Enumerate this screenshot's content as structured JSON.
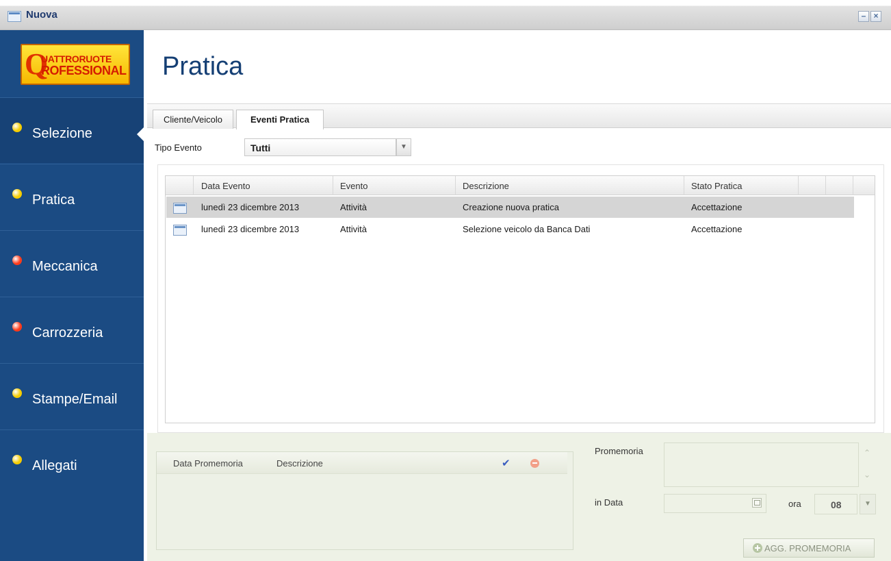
{
  "window": {
    "title": "Nuova",
    "minimize_glyph": "–",
    "close_glyph": "×"
  },
  "logo": {
    "initial": "Q",
    "line1": "UATTRORUOTE",
    "line2": "ROFESSIONAL"
  },
  "sidebar": {
    "items": [
      {
        "label": "Selezione",
        "dot_color": "#f5cc00",
        "active": true
      },
      {
        "label": "Pratica",
        "dot_color": "#f5cc00",
        "active": false
      },
      {
        "label": "Meccanica",
        "dot_color": "#ff3a1a",
        "active": false
      },
      {
        "label": "Carrozzeria",
        "dot_color": "#ff3a1a",
        "active": false
      },
      {
        "label": "Stampe/Email",
        "dot_color": "#f5cc00",
        "active": false
      },
      {
        "label": "Allegati",
        "dot_color": "#f5cc00",
        "active": false
      }
    ]
  },
  "page": {
    "title": "Pratica"
  },
  "tabs": [
    {
      "label": "Cliente/Veicolo",
      "active": false
    },
    {
      "label": "Eventi Pratica",
      "active": true
    }
  ],
  "filter": {
    "label": "Tipo Evento",
    "value": "Tutti",
    "icon": "chevron-down-icon"
  },
  "events_table": {
    "columns": [
      "Data Evento",
      "Evento",
      "Descrizione",
      "Stato Pratica"
    ],
    "rows": [
      {
        "date": "lunedì 23 dicembre 2013",
        "event": "Attività",
        "description": "Creazione nuova pratica",
        "status": "Accettazione",
        "selected": true
      },
      {
        "date": "lunedì 23 dicembre 2013",
        "event": "Attività",
        "description": "Selezione veicolo da Banca Dati",
        "status": "Accettazione",
        "selected": false
      }
    ]
  },
  "reminders": {
    "columns": [
      "Data Promemoria",
      "Descrizione"
    ],
    "form": {
      "note_label": "Promemoria",
      "date_label": "in Data",
      "hour_label": "ora",
      "hour_value": "08",
      "add_button": "AGG. PROMEMORIA"
    }
  },
  "colors": {
    "sidebar_bg": "#1b4b83",
    "title_color": "#153f74",
    "bottom_panel_bg": "#eef2e6",
    "selected_row_bg": "#d5d5d5"
  }
}
